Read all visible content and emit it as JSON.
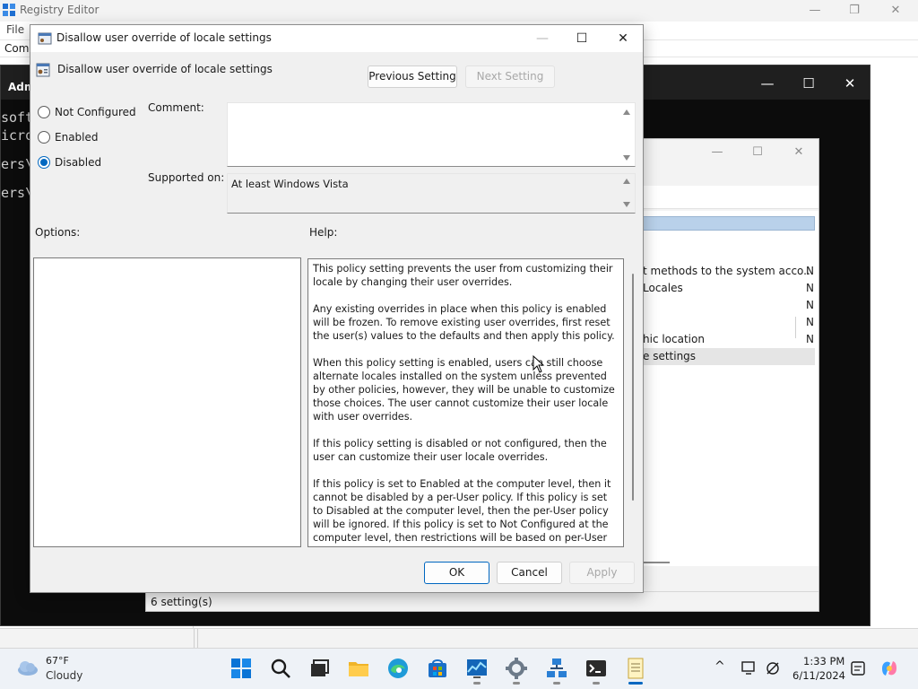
{
  "registry": {
    "title": "Registry Editor",
    "menu_file": "File",
    "address_partial": "Comp",
    "controls": {
      "minimize": "—",
      "maximize": "❐",
      "close": "✕"
    }
  },
  "terminal": {
    "title_partial": "Adm",
    "lines": [
      "soft",
      "icro",
      "",
      "ers\\",
      "",
      "ers\\"
    ],
    "controls": {
      "minimize": "—",
      "maximize": "☐",
      "close": "✕"
    }
  },
  "gpe": {
    "rows": [
      {
        "name": "t methods to the system acco...",
        "state": "N"
      },
      {
        "name": "Locales",
        "state": "N"
      },
      {
        "name": "",
        "state": "N"
      },
      {
        "name": "",
        "state": "N"
      },
      {
        "name": "hic location",
        "state": "N"
      },
      {
        "name": "e settings",
        "state": ""
      }
    ],
    "status": "6 setting(s)",
    "controls": {
      "minimize": "—",
      "maximize": "☐",
      "close": "✕"
    }
  },
  "dialog": {
    "title": "Disallow user override of locale settings",
    "heading": "Disallow user override of locale settings",
    "controls": {
      "minimize": "—",
      "maximize": "☐",
      "close": "✕"
    },
    "previous_setting": "Previous Setting",
    "next_setting": "Next Setting",
    "radio": {
      "not_configured": "Not Configured",
      "enabled": "Enabled",
      "disabled": "Disabled",
      "selected": "disabled"
    },
    "comment_label": "Comment:",
    "comment_value": "",
    "supported_label": "Supported on:",
    "supported_value": "At least Windows Vista",
    "options_label": "Options:",
    "help_label": "Help:",
    "help_paragraphs": [
      "This policy setting prevents the user from customizing their locale by changing their user overrides.",
      "Any existing overrides in place when this policy is enabled will be frozen. To remove existing user overrides, first reset the user(s) values to the defaults and then apply this policy.",
      "When this policy setting is enabled, users can still choose alternate locales installed on the system unless prevented by other policies, however, they will be unable to customize those choices.  The user cannot customize their user locale with user overrides.",
      "If this policy setting is disabled or not configured, then the user can customize their user locale overrides.",
      "If this policy is set to Enabled at the computer level, then it cannot be disabled by a per-User policy. If this policy is set to Disabled at the computer level, then the per-User policy will be ignored. If this policy is set to Not Configured at the computer level, then restrictions will be based on per-User policies."
    ],
    "ok": "OK",
    "cancel": "Cancel",
    "apply": "Apply"
  },
  "taskbar": {
    "temperature": "67°F",
    "condition": "Cloudy",
    "time": "1:33 PM",
    "date": "6/11/2024",
    "accent": "#0067c0"
  }
}
